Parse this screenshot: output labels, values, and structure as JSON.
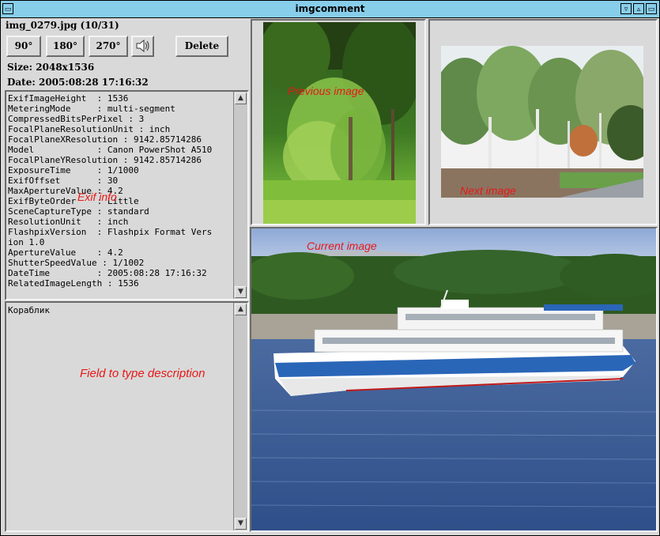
{
  "window": {
    "title": "imgcomment",
    "controls": [
      "minimize-icon",
      "maximize-icon",
      "close-icon"
    ]
  },
  "file": {
    "name": "img_0279.jpg (10/31)",
    "size": "Size: 2048x1536",
    "date": "Date: 2005:08:28 17:16:32"
  },
  "toolbar": {
    "rotate90": "90°",
    "rotate180": "180°",
    "rotate270": "270°",
    "delete": "Delete",
    "sound_icon": "speaker-icon"
  },
  "exif_lines": [
    "ExifImageHeight  : 1536",
    "MeteringMode     : multi-segment",
    "CompressedBitsPerPixel : 3",
    "FocalPlaneResolutionUnit : inch",
    "FocalPlaneXResolution : 9142.85714286",
    "Model            : Canon PowerShot A510",
    "FocalPlaneYResolution : 9142.85714286",
    "ExposureTime     : 1/1000",
    "ExifOffset       : 30",
    "MaxApertureValue : 4.2",
    "ExifByteOrder    : Little",
    "SceneCaptureType : standard",
    "ResolutionUnit   : inch",
    "FlashpixVersion  : Flashpix Format Vers",
    "ion 1.0",
    "ApertureValue    : 4.2",
    "ShutterSpeedValue : 1/1002",
    "DateTime         : 2005:08:28 17:16:32",
    "RelatedImageLength : 1536"
  ],
  "description": {
    "value": "Кораблик"
  },
  "annotations": {
    "previous": "Previous image",
    "next": "Next image",
    "current": "Current image",
    "exif": "Exif info",
    "field": "Field to type description"
  },
  "colors": {
    "titlebar": "#87ceeb",
    "background": "#d9d9d9",
    "annotation": "#e81818"
  }
}
